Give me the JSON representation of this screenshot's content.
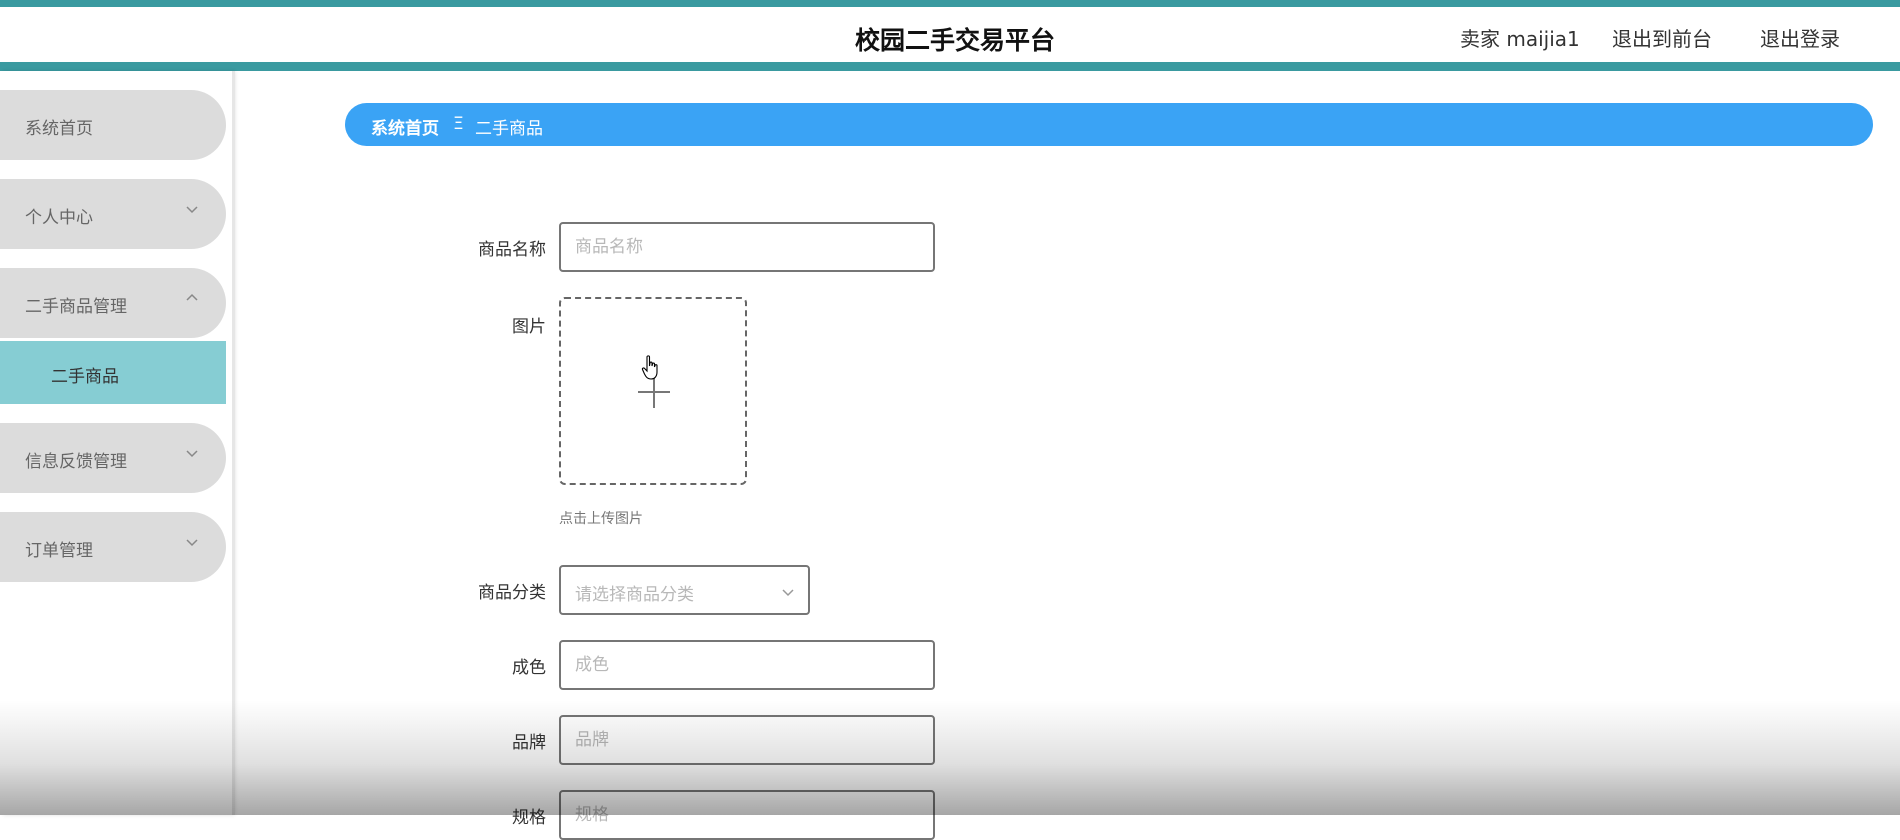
{
  "header": {
    "site_title": "校园二手交易平台",
    "seller_label": "卖家 maijia1",
    "front_link": "退出到前台",
    "logout_link": "退出登录"
  },
  "sidebar": {
    "items": [
      {
        "label": "系统首页",
        "expandable": false
      },
      {
        "label": "个人中心",
        "expandable": true,
        "expanded": false
      },
      {
        "label": "二手商品管理",
        "expandable": true,
        "expanded": true
      },
      {
        "label": "信息反馈管理",
        "expandable": true,
        "expanded": false
      },
      {
        "label": "订单管理",
        "expandable": true,
        "expanded": false
      }
    ],
    "sub_item": {
      "label": "二手商品",
      "active": true
    }
  },
  "breadcrumb": {
    "home": "系统首页",
    "separator": "Ξ",
    "current": "二手商品"
  },
  "form": {
    "name_label": "商品名称",
    "name_placeholder": "商品名称",
    "image_label": "图片",
    "upload_hint": "点击上传图片",
    "category_label": "商品分类",
    "category_placeholder": "请选择商品分类",
    "condition_label": "成色",
    "condition_placeholder": "成色",
    "brand_label": "品牌",
    "brand_placeholder": "品牌",
    "spec_label": "规格",
    "spec_placeholder": "规格"
  },
  "colors": {
    "teal_bar": "#3a9aa0",
    "breadcrumb_bg": "#3aa3f5",
    "menu_bg": "#dcdcdc",
    "submenu_active_bg": "#86cdd3"
  }
}
